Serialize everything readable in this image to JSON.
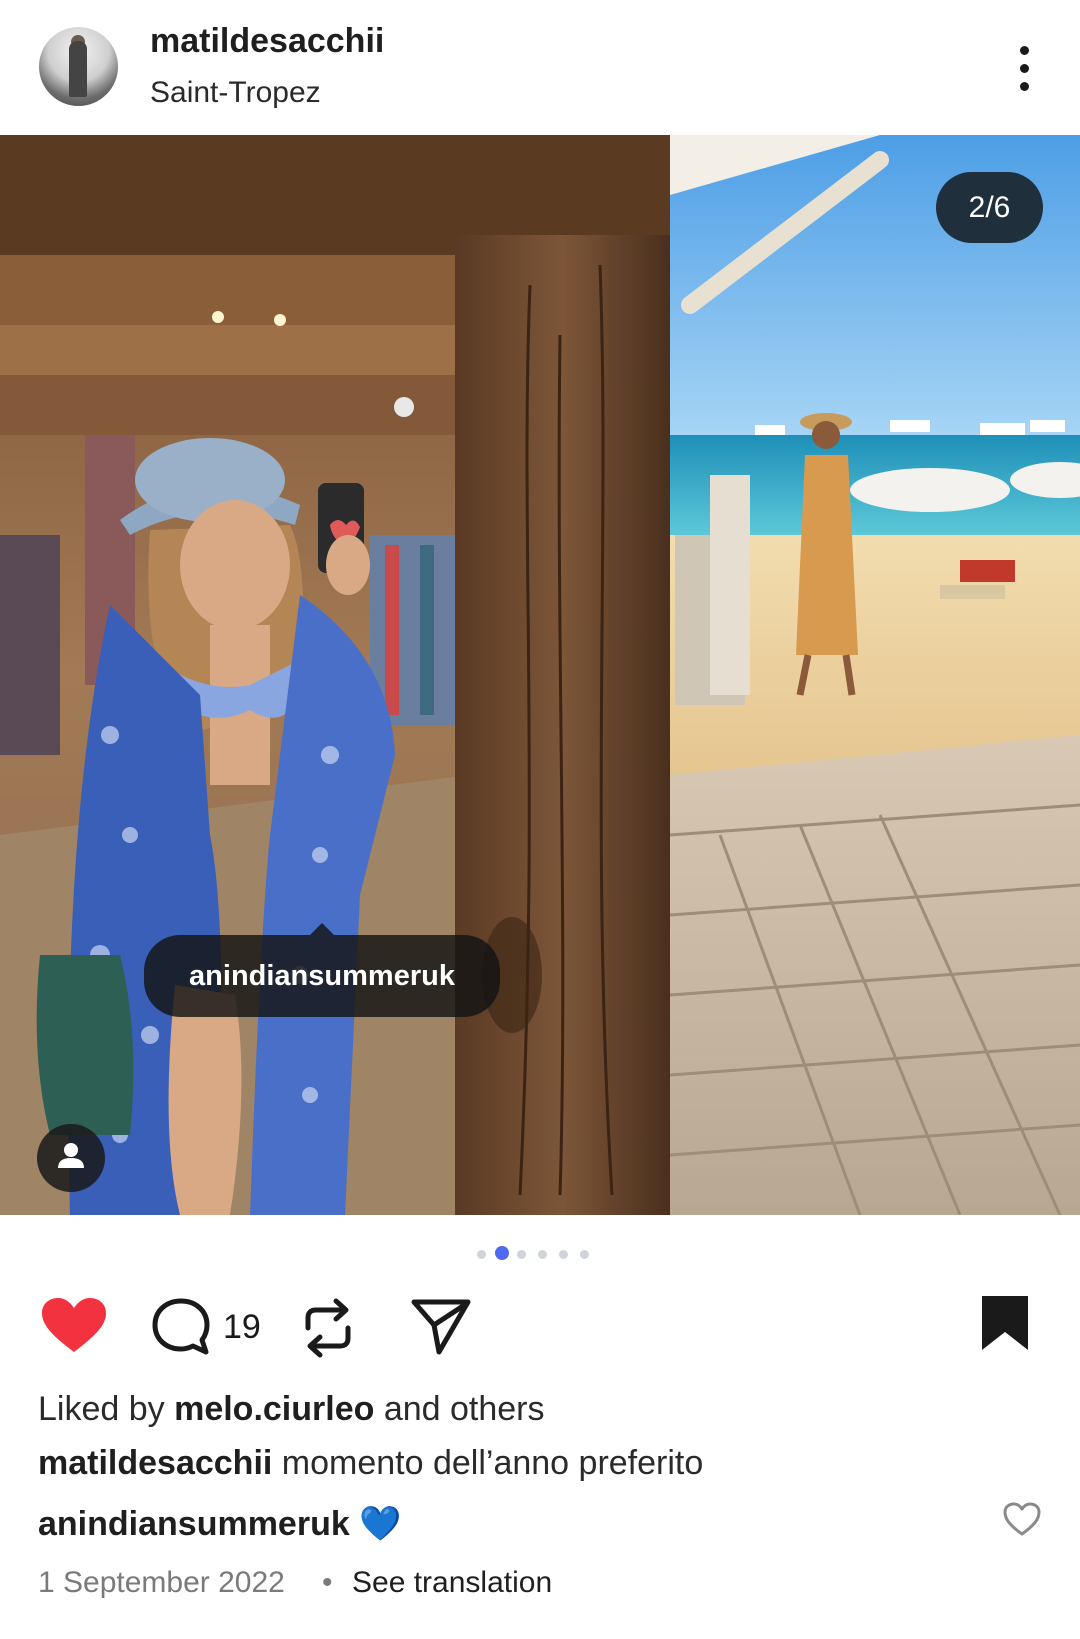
{
  "post": {
    "username": "matildesacchii",
    "location": "Saint-Tropez",
    "image_counter": "2/6",
    "current_image": 2,
    "total_images": 6,
    "tagged_user": "anindiansummeruk"
  },
  "actions": {
    "liked": true,
    "comment_count": "19",
    "saved": true
  },
  "caption": {
    "liked_by_prefix": "Liked by",
    "liked_by_user": "melo.ciurleo",
    "liked_by_suffix": "and others",
    "author": "matildesacchii",
    "text": "momento dell’anno preferito",
    "comment_user": "anindiansummeruk",
    "comment_text": "💙",
    "date": "1 September 2022",
    "separator": "•",
    "translate": "See translation"
  },
  "icons": {
    "more": "more-vertical-icon",
    "like": "heart-filled-icon",
    "comment": "comment-icon",
    "repost": "repost-icon",
    "share": "send-icon",
    "save": "bookmark-filled-icon",
    "comment_like": "heart-outline-icon",
    "user_tags": "person-icon"
  },
  "colors": {
    "like_red": "#f2333f",
    "dot_active": "#4f6af0",
    "dot_inactive": "#cfd3da",
    "heart_emoji_blue": "#2f7de1"
  }
}
